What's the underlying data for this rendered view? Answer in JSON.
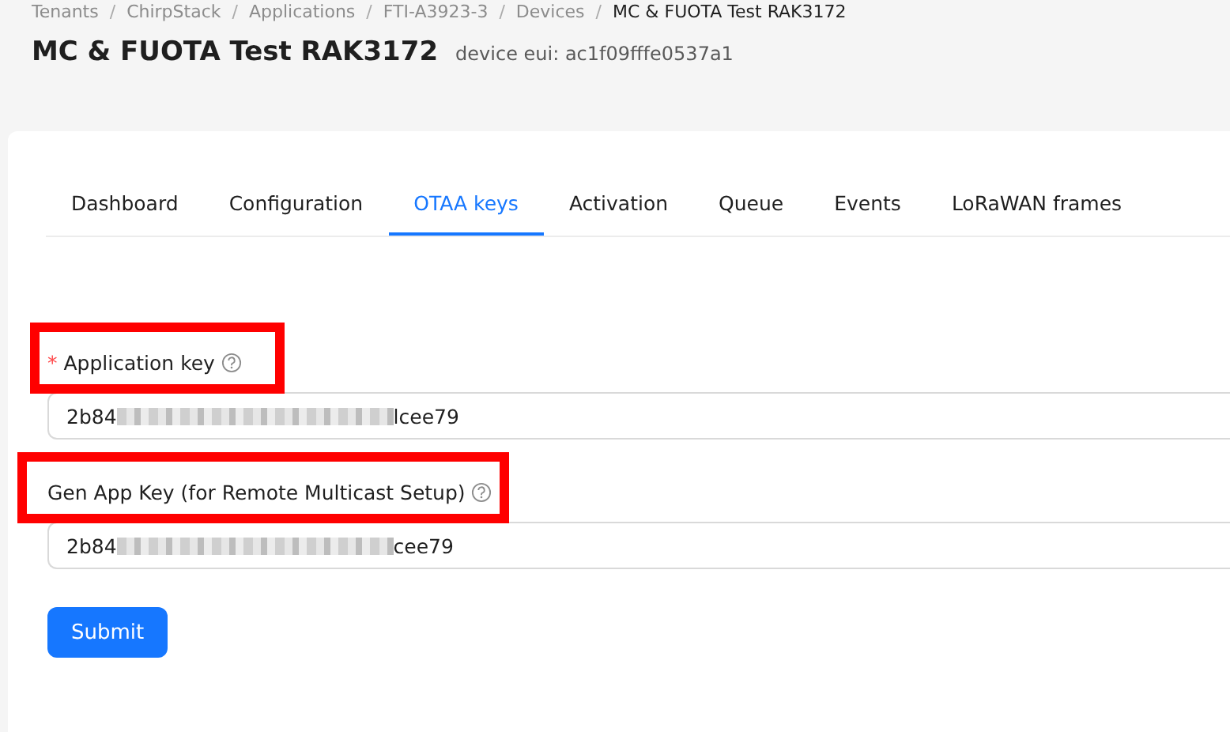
{
  "breadcrumb": {
    "separator": "/",
    "items": [
      "Tenants",
      "ChirpStack",
      "Applications",
      "FTI-A3923-3",
      "Devices",
      "MC & FUOTA Test RAK3172"
    ]
  },
  "header": {
    "title": "MC & FUOTA Test RAK3172",
    "subtitle": "device eui: ac1f09fffe0537a1"
  },
  "tabs": [
    {
      "label": "Dashboard",
      "selected": false
    },
    {
      "label": "Configuration",
      "selected": false
    },
    {
      "label": "OTAA keys",
      "selected": true
    },
    {
      "label": "Activation",
      "selected": false
    },
    {
      "label": "Queue",
      "selected": false
    },
    {
      "label": "Events",
      "selected": false
    },
    {
      "label": "LoRaWAN frames",
      "selected": false
    }
  ],
  "fields": [
    {
      "required_mark": "*",
      "label": "Application key",
      "highlighted": true,
      "value_start": "2b84",
      "value_end": "lcee79",
      "masked": true
    },
    {
      "label": "Gen App Key (for Remote Multicast Setup)",
      "highlighted": true,
      "value_start": "2b84",
      "value_end": "cee79",
      "masked": true
    }
  ],
  "submit_button": "Submit"
}
